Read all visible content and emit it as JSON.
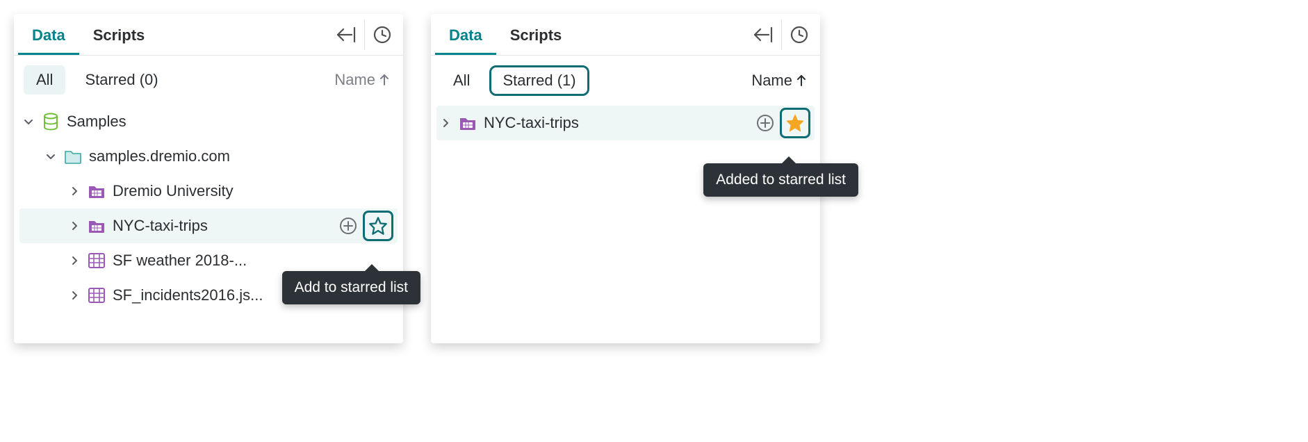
{
  "panelA": {
    "tabs": {
      "data": "Data",
      "scripts": "Scripts"
    },
    "filter": {
      "all": "All",
      "starred": "Starred (0)"
    },
    "sort": {
      "label": "Name"
    },
    "tree": {
      "samples": "Samples",
      "domain": "samples.dremio.com",
      "items": [
        {
          "label": "Dremio University"
        },
        {
          "label": "NYC-taxi-trips"
        },
        {
          "label": "SF weather 2018-..."
        },
        {
          "label": "SF_incidents2016.js..."
        }
      ]
    },
    "tooltip": "Add to starred list"
  },
  "panelB": {
    "tabs": {
      "data": "Data",
      "scripts": "Scripts"
    },
    "filter": {
      "all": "All",
      "starred": "Starred (1)"
    },
    "sort": {
      "label": "Name"
    },
    "list": {
      "item": "NYC-taxi-trips"
    },
    "tooltip": "Added to starred list"
  },
  "colors": {
    "teal": "#008489",
    "purple": "#9b59b6",
    "orange": "#f5a623"
  }
}
